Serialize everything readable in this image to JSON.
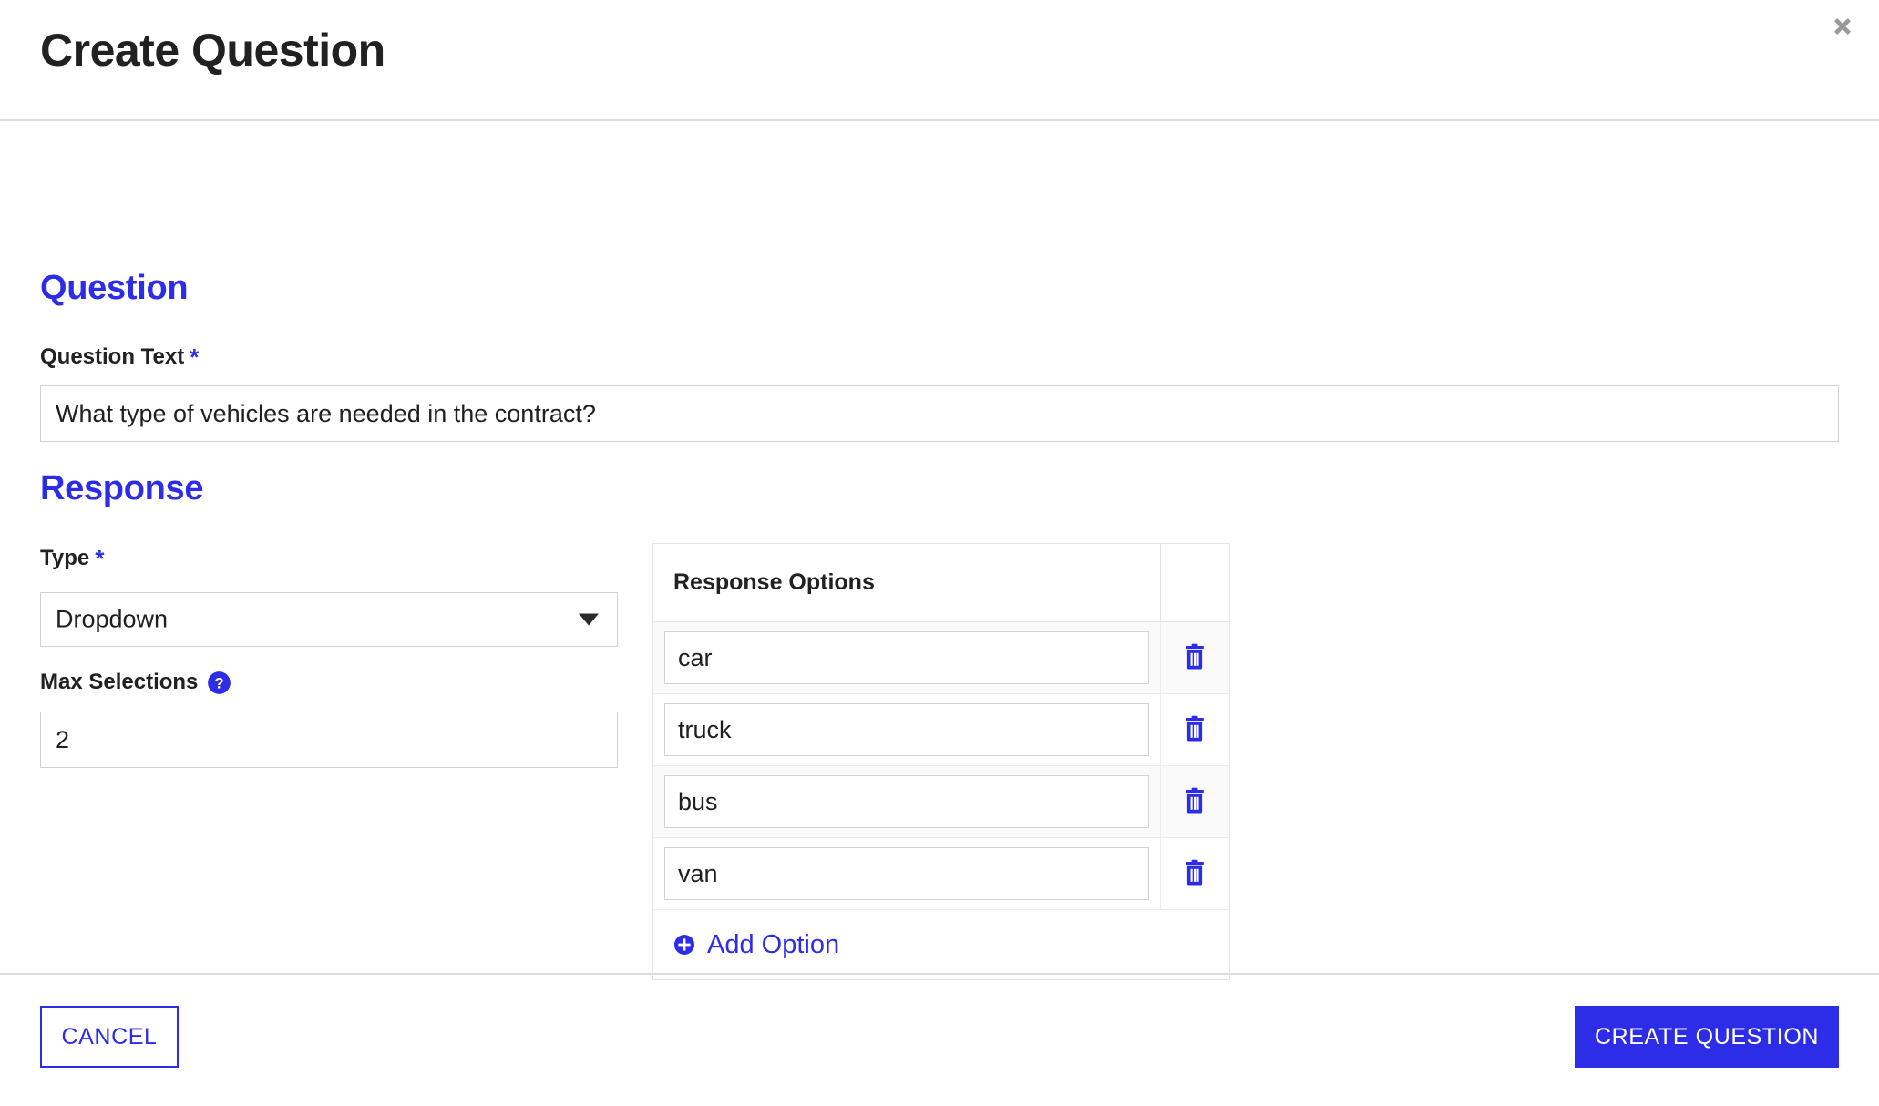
{
  "modal": {
    "title": "Create Question",
    "close_icon": "close-icon"
  },
  "question_section": {
    "heading": "Question",
    "question_text": {
      "label": "Question Text",
      "required_marker": "*",
      "value": "What type of vehicles are needed in the contract?",
      "placeholder": ""
    }
  },
  "response_section": {
    "heading": "Response",
    "type": {
      "label": "Type",
      "required_marker": "*",
      "selected": "Dropdown",
      "dropdown_icon": "chevron-down-icon"
    },
    "max_selections": {
      "label": "Max Selections",
      "help_icon": "question-mark-help-icon",
      "value": "2",
      "placeholder": ""
    },
    "options_table": {
      "column_header": "Response Options",
      "rows": [
        {
          "value": "car",
          "delete_icon": "trash-icon"
        },
        {
          "value": "truck",
          "delete_icon": "trash-icon"
        },
        {
          "value": "bus",
          "delete_icon": "trash-icon"
        },
        {
          "value": "van",
          "delete_icon": "trash-icon"
        }
      ],
      "add_option_label": "Add Option",
      "add_option_icon": "plus-circle-icon"
    }
  },
  "footer": {
    "cancel_label": "CANCEL",
    "submit_label": "CREATE QUESTION"
  },
  "colors": {
    "accent_blue": "#2D2DE8",
    "text_dark": "#212121",
    "border_gray": "#d2d2d2",
    "row_alt": "#fafafa",
    "close_gray": "#999999"
  }
}
